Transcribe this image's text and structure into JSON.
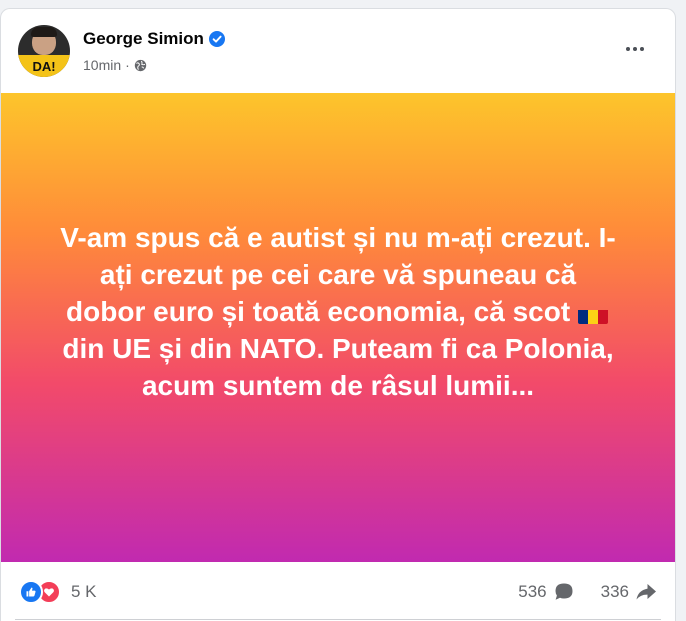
{
  "post": {
    "author": "George Simion",
    "time": "10min",
    "separator": "·",
    "avatar_text": "DA!",
    "text_part1": "V-am spus că e autist și nu m-ați crezut. I-ați crezut pe cei care vă spuneau că dobor euro și toată economia, că scot ",
    "text_part2": "din UE și din NATO. Puteam fi ca Polonia, acum suntem de râsul lumii...",
    "flag_colors": [
      "#002b7f",
      "#fcd116",
      "#ce1126"
    ],
    "background_colors": [
      "#fdc52b",
      "#ff8a3a",
      "#f24a6a",
      "#c12ab0"
    ]
  },
  "footer": {
    "reactions_count": "5 K",
    "comments_count": "536",
    "shares_count": "336"
  },
  "icons": {
    "verified": "verified-badge-icon",
    "privacy": "globe-icon",
    "more": "more-options-icon",
    "like": "like-icon",
    "love": "love-icon",
    "comment": "comment-icon",
    "share": "share-icon"
  },
  "colors": {
    "accent": "#1877f2",
    "love": "#f33e58",
    "text_secondary": "#65676b"
  }
}
